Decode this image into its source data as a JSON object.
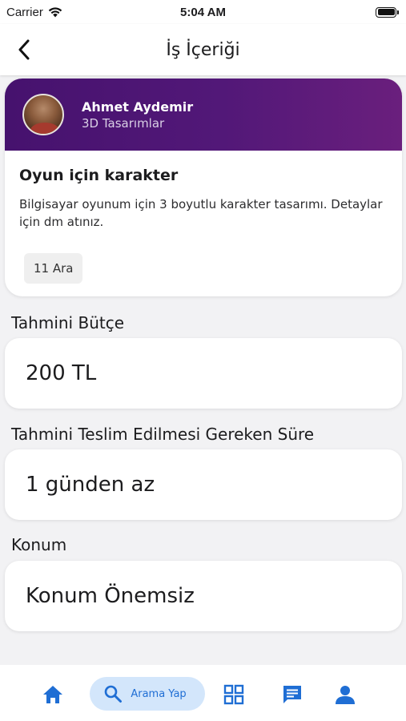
{
  "status_bar": {
    "carrier": "Carrier",
    "time": "5:04 AM"
  },
  "nav": {
    "title": "İş İçeriği"
  },
  "job": {
    "author_name": "Ahmet Aydemir",
    "author_category": "3D Tasarımlar",
    "title": "Oyun için karakter",
    "description": "Bilgisayar oyunum için 3 boyutlu karakter tasarımı. Detaylar için dm atınız.",
    "date": "11 Ara"
  },
  "budget": {
    "label": "Tahmini Bütçe",
    "value": "200 TL"
  },
  "duration": {
    "label": "Tahmini Teslim Edilmesi Gereken Süre",
    "value": "1 günden az"
  },
  "location": {
    "label": "Konum",
    "value": "Konum Önemsiz"
  },
  "tab_bar": {
    "search_label": "Arama Yap",
    "active_color": "#1f6ed4",
    "search_bg": "#d3e6fb"
  },
  "colors": {
    "header_gradient_start": "#46126e",
    "header_gradient_end": "#6a1f7d",
    "background": "#f2f2f4"
  },
  "icons": [
    "wifi-icon",
    "battery-icon",
    "back-chevron-icon",
    "home-icon",
    "search-icon",
    "grid-icon",
    "chat-icon",
    "profile-icon"
  ]
}
